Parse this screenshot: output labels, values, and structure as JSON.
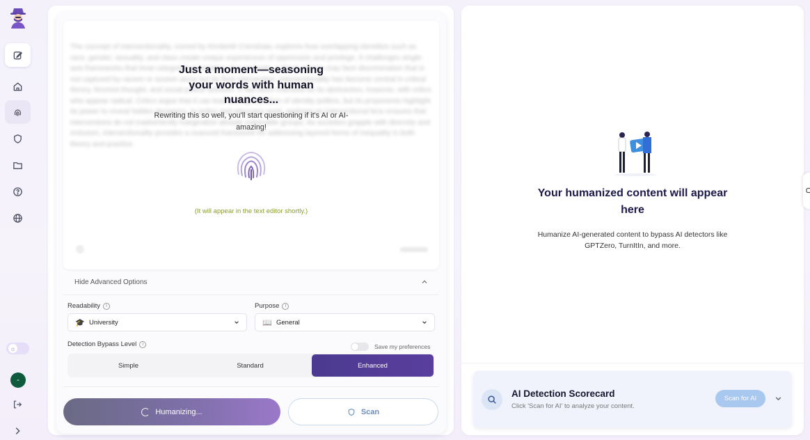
{
  "sidebar": {
    "nav": [
      "edit-icon",
      "home-icon",
      "fingerprint-icon",
      "shield-icon",
      "folder-icon",
      "help-icon",
      "globe-icon"
    ],
    "theme_icon": "☼",
    "avatar_initial": "-"
  },
  "editor": {
    "blurred_text": "The concept of intersectionality, coined by Kimberlé Crenshaw, explores how overlapping identities such as race, gender, sexuality, and class create unique experiences of oppression and privilege. It challenges single-axis frameworks that treat categories in isolation. For example, a Black woman may face discrimination that is not captured by racism or sexism alone but by their intersection. Intersectionality has become central in critical theory, feminist thought, and social justice activism. It has been criticized for its abstraction, however, with critics who appear radical. Critics argue that it can lead to fragmentation of identity politics, but its proponents highlight its power to reveal hidden dynamics. In policy and advocacy work, applying an intersectional lens ensures that interventions do not inadvertently marginalize already vulnerable groups. As societies grapple with diversity and inclusion, intersectionality provides a nuanced framework for addressing layered forms of inequality in both theory and practice.",
    "loading_title": "Just a moment—seasoning your words with human nuances...",
    "loading_subtitle": "Rewriting this so well, you'll start questioning if it's AI or AI-amazing!",
    "appear_note": "(It will appear in the text editor shortly.)"
  },
  "advanced": {
    "toggle_label": "Hide Advanced Options",
    "readability_label": "Readability",
    "readability_value": "University",
    "readability_icon": "🎓",
    "purpose_label": "Purpose",
    "purpose_value": "General",
    "purpose_icon": "📖",
    "bypass_label": "Detection Bypass Level",
    "save_pref_label": "Save my preferences",
    "levels": [
      "Simple",
      "Standard",
      "Enhanced"
    ],
    "selected_level": "Enhanced"
  },
  "actions": {
    "humanize_label": "Humanizing...",
    "scan_label": "Scan"
  },
  "output": {
    "empty_title": "Your humanized content will appear here",
    "empty_desc": "Humanize AI-generated content to bypass AI detectors like GPTZero, TurnItIn, and more."
  },
  "scorecard": {
    "title": "AI Detection Scorecard",
    "subtitle": "Click 'Scan for AI' to analyze your content.",
    "button": "Scan for AI"
  }
}
